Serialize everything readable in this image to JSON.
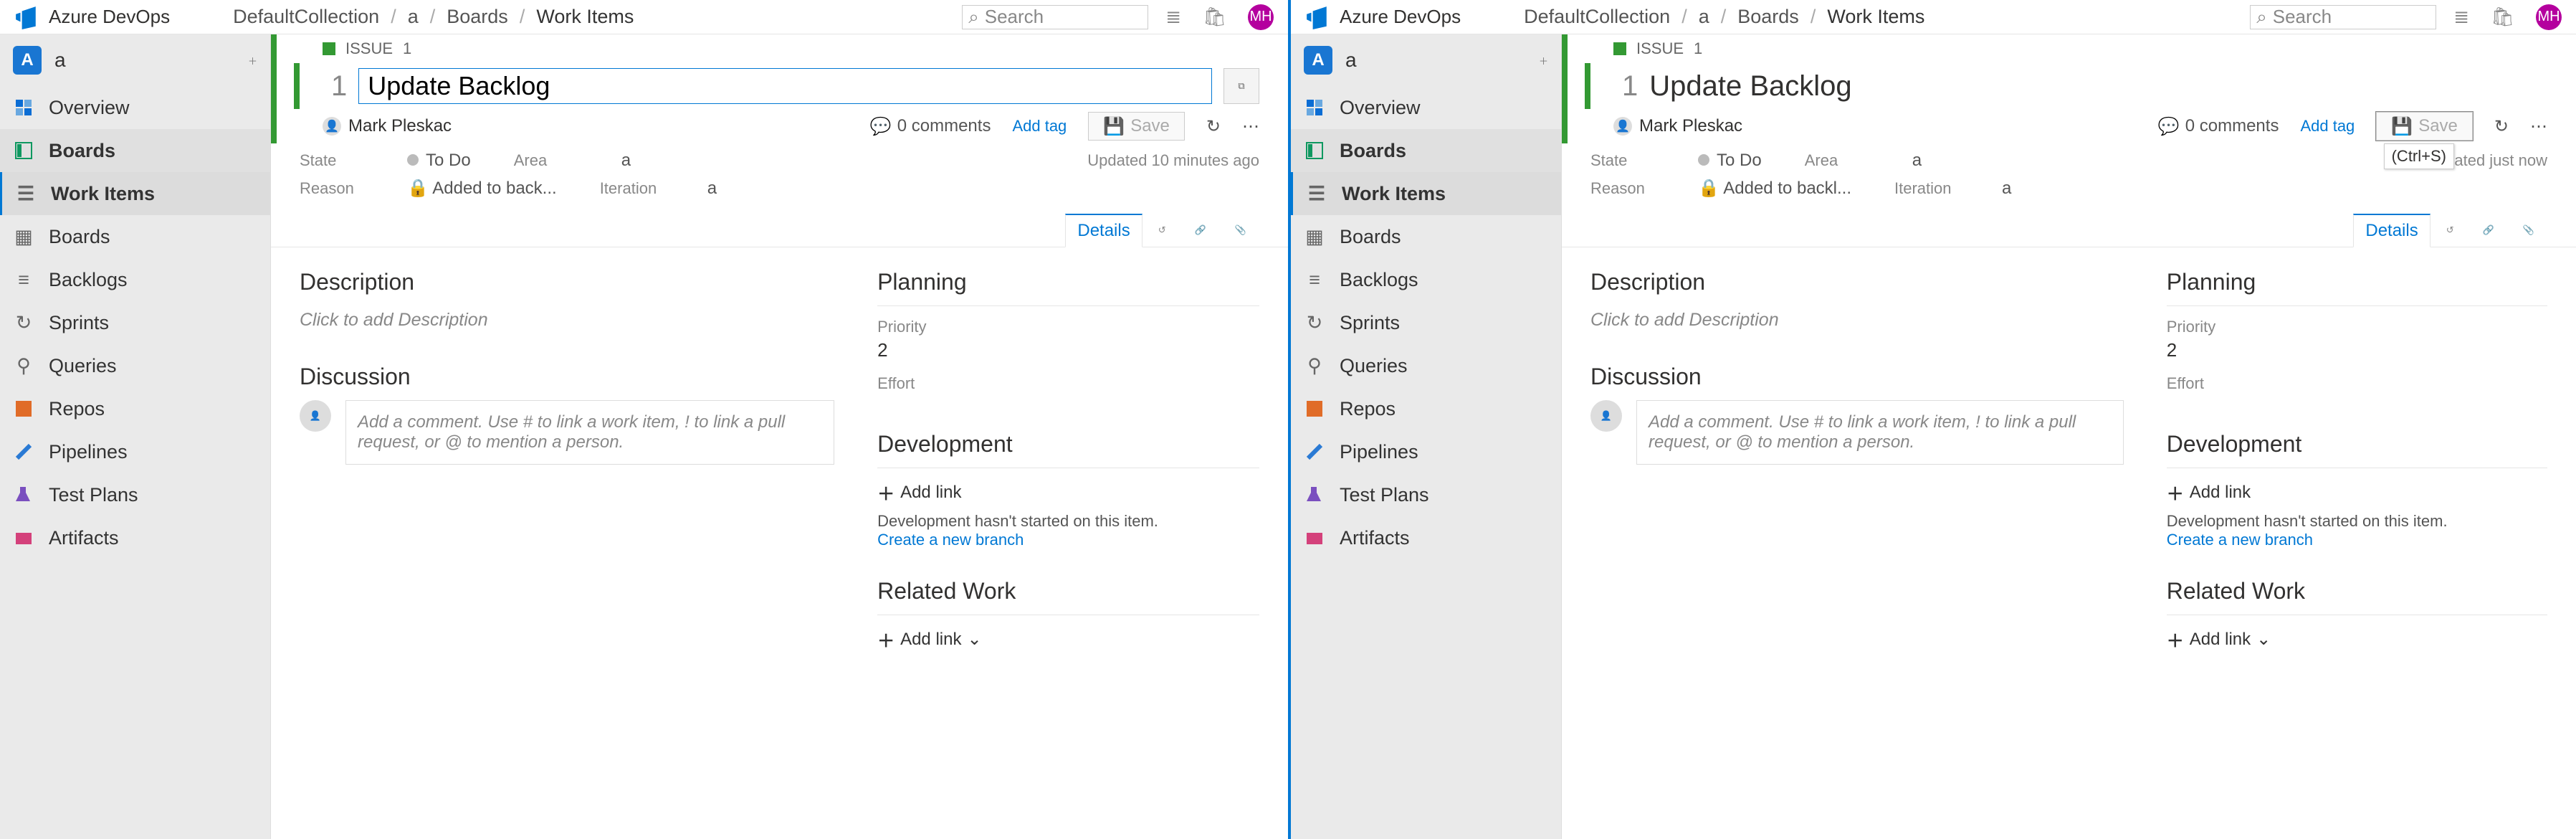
{
  "brand": "Azure DevOps",
  "breadcrumbs": {
    "collection": "DefaultCollection",
    "project": "a",
    "section": "Boards",
    "page": "Work Items"
  },
  "search": {
    "placeholder": "Search"
  },
  "avatar": "MH",
  "project": {
    "letter": "A",
    "name": "a"
  },
  "sidebar": {
    "overview": "Overview",
    "boards": "Boards",
    "workitems": "Work Items",
    "boards2": "Boards",
    "backlogs": "Backlogs",
    "sprints": "Sprints",
    "queries": "Queries",
    "repos": "Repos",
    "pipelines": "Pipelines",
    "testplans": "Test Plans",
    "artifacts": "Artifacts"
  },
  "issue": {
    "type": "ISSUE",
    "num": "1",
    "title": "Update Backlog",
    "assignee": "Mark Pleskac",
    "comments_label": "0 comments",
    "add_tag": "Add tag",
    "save": "Save",
    "state_label": "State",
    "state": "To Do",
    "area_label": "Area",
    "area": "a",
    "reason_label": "Reason",
    "reason_left": "Added to back...",
    "reason_right": "Added to backl...",
    "iteration_label": "Iteration",
    "iteration": "a",
    "updated_left": "Updated 10 minutes ago",
    "updated_right": "Updated just now"
  },
  "tabs": {
    "details": "Details"
  },
  "sections": {
    "description": "Description",
    "desc_placeholder": "Click to add Description",
    "discussion": "Discussion",
    "disc_placeholder": "Add a comment. Use # to link a work item, ! to link a pull request, or @ to mention a person.",
    "planning": "Planning",
    "priority": "Priority",
    "priority_val": "2",
    "effort": "Effort",
    "development": "Development",
    "add_link": "Add link",
    "dev_not_started": "Development hasn't started on this item.",
    "new_branch": "Create a new branch",
    "related": "Related Work",
    "add_link_drop": "Add link"
  },
  "tooltip": {
    "save": "(Ctrl+S)"
  }
}
